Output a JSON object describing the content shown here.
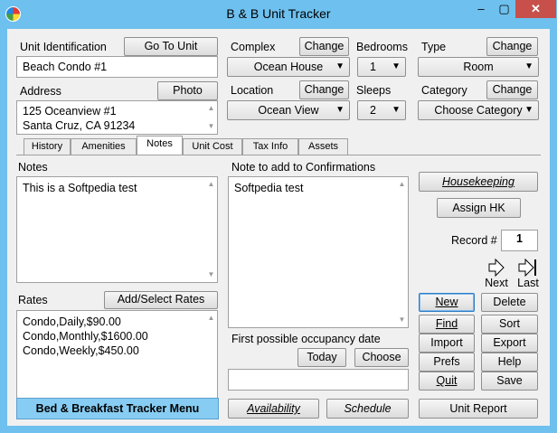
{
  "window": {
    "title": "B & B Unit Tracker",
    "min": "–",
    "max": "▢",
    "close": "✕"
  },
  "unit": {
    "label": "Unit Identification",
    "goto": "Go To Unit",
    "value": "Beach Condo #1"
  },
  "address": {
    "label": "Address",
    "photo": "Photo",
    "lines": [
      "125 Oceanview #1",
      "Santa Cruz, CA 91234"
    ]
  },
  "complex": {
    "label": "Complex",
    "change": "Change",
    "value": "Ocean House"
  },
  "location": {
    "label": "Location",
    "change": "Change",
    "value": "Ocean View"
  },
  "bedrooms": {
    "label": "Bedrooms",
    "value": "1"
  },
  "sleeps": {
    "label": "Sleeps",
    "value": "2"
  },
  "type": {
    "label": "Type",
    "change": "Change",
    "value": "Room"
  },
  "category": {
    "label": "Category",
    "change": "Change",
    "value": "Choose Category"
  },
  "tabs": [
    "History",
    "Amenities",
    "Notes",
    "Unit Cost",
    "Tax Info",
    "Assets"
  ],
  "notes": {
    "label": "Notes",
    "text": "This is a Softpedia test"
  },
  "confirm": {
    "label": "Note to add to Confirmations",
    "text": "Softpedia test"
  },
  "rates": {
    "label": "Rates",
    "button": "Add/Select Rates",
    "items": [
      "Condo,Daily,$90.00",
      "Condo,Monthly,$1600.00",
      "Condo,Weekly,$450.00"
    ]
  },
  "occupancy": {
    "label": "First possible occupancy date",
    "today": "Today",
    "choose": "Choose",
    "value": ""
  },
  "side": {
    "housekeeping": "Housekeeping",
    "assign": "Assign HK",
    "record_label": "Record #",
    "record": "1",
    "next": "Next",
    "last": "Last",
    "buttons": [
      "New",
      "Delete",
      "Find",
      "Sort",
      "Import",
      "Export",
      "Prefs",
      "Help",
      "Quit",
      "Save"
    ]
  },
  "bottom": {
    "menu": "Bed & Breakfast Tracker Menu",
    "availability": "Availability",
    "schedule": "Schedule",
    "report": "Unit Report"
  }
}
